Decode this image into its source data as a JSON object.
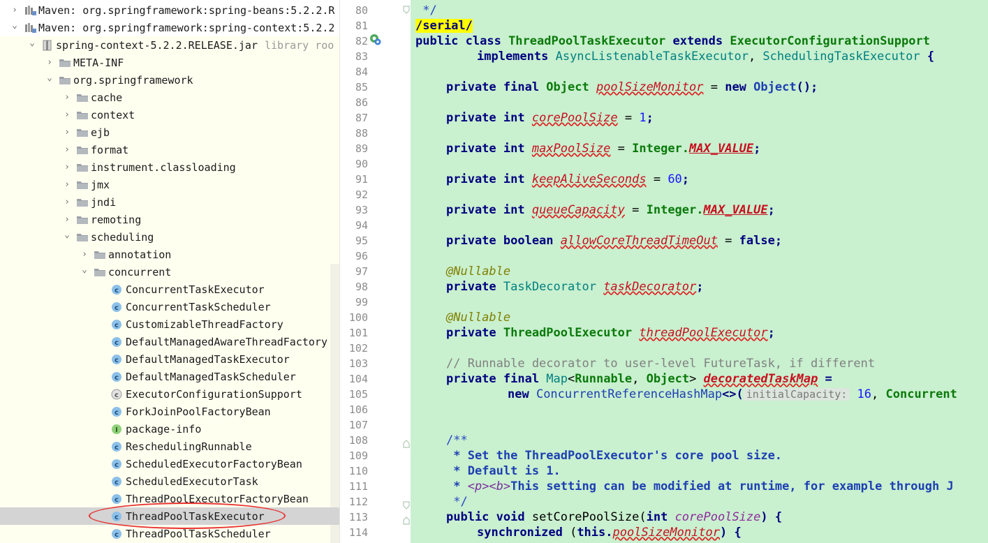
{
  "tree": {
    "rows": [
      {
        "label": "Maven: org.springframework:spring-beans:5.2.2.R",
        "arrow": "›",
        "icon": "library-icon",
        "indent": 0
      },
      {
        "label": "Maven: org.springframework:spring-context:5.2.2",
        "arrow": "⌄",
        "icon": "library-icon",
        "indent": 0
      },
      {
        "label": "spring-context-5.2.2.RELEASE.jar",
        "hint": "library roo",
        "arrow": "⌄",
        "icon": "jar-icon",
        "indent": 1
      },
      {
        "label": "META-INF",
        "arrow": "›",
        "icon": "folder-icon",
        "indent": 2
      },
      {
        "label": "org.springframework",
        "arrow": "⌄",
        "icon": "folder-icon",
        "indent": 2
      },
      {
        "label": "cache",
        "arrow": "›",
        "icon": "folder-icon",
        "indent": 3
      },
      {
        "label": "context",
        "arrow": "›",
        "icon": "folder-icon",
        "indent": 3
      },
      {
        "label": "ejb",
        "arrow": "›",
        "icon": "folder-icon",
        "indent": 3
      },
      {
        "label": "format",
        "arrow": "›",
        "icon": "folder-icon",
        "indent": 3
      },
      {
        "label": "instrument.classloading",
        "arrow": "›",
        "icon": "folder-icon",
        "indent": 3
      },
      {
        "label": "jmx",
        "arrow": "›",
        "icon": "folder-icon",
        "indent": 3
      },
      {
        "label": "jndi",
        "arrow": "›",
        "icon": "folder-icon",
        "indent": 3
      },
      {
        "label": "remoting",
        "arrow": "›",
        "icon": "folder-icon",
        "indent": 3
      },
      {
        "label": "scheduling",
        "arrow": "⌄",
        "icon": "folder-icon",
        "indent": 3
      },
      {
        "label": "annotation",
        "arrow": "›",
        "icon": "folder-icon",
        "indent": 4
      },
      {
        "label": "concurrent",
        "arrow": "⌄",
        "icon": "folder-icon",
        "indent": 4
      },
      {
        "label": "ConcurrentTaskExecutor",
        "arrow": "",
        "icon": "class-icon",
        "indent": 5
      },
      {
        "label": "ConcurrentTaskScheduler",
        "arrow": "",
        "icon": "class-icon",
        "indent": 5
      },
      {
        "label": "CustomizableThreadFactory",
        "arrow": "",
        "icon": "class-icon",
        "indent": 5
      },
      {
        "label": "DefaultManagedAwareThreadFactory",
        "arrow": "",
        "icon": "class-icon",
        "indent": 5
      },
      {
        "label": "DefaultManagedTaskExecutor",
        "arrow": "",
        "icon": "class-icon",
        "indent": 5
      },
      {
        "label": "DefaultManagedTaskScheduler",
        "arrow": "",
        "icon": "class-icon",
        "indent": 5
      },
      {
        "label": "ExecutorConfigurationSupport",
        "arrow": "",
        "icon": "abstract-class-icon",
        "indent": 5
      },
      {
        "label": "ForkJoinPoolFactoryBean",
        "arrow": "",
        "icon": "class-icon",
        "indent": 5
      },
      {
        "label": "package-info",
        "arrow": "",
        "icon": "interface-icon",
        "indent": 5
      },
      {
        "label": "ReschedulingRunnable",
        "arrow": "",
        "icon": "class-icon",
        "indent": 5
      },
      {
        "label": "ScheduledExecutorFactoryBean",
        "arrow": "",
        "icon": "class-icon",
        "indent": 5
      },
      {
        "label": "ScheduledExecutorTask",
        "arrow": "",
        "icon": "class-icon",
        "indent": 5
      },
      {
        "label": "ThreadPoolExecutorFactoryBean",
        "arrow": "",
        "icon": "class-icon",
        "indent": 5
      },
      {
        "label": "ThreadPoolTaskExecutor",
        "arrow": "",
        "icon": "class-icon",
        "indent": 5,
        "selected": true
      },
      {
        "label": "ThreadPoolTaskScheduler",
        "arrow": "",
        "icon": "class-icon",
        "indent": 5
      }
    ]
  },
  "gutter": {
    "line_numbers": [
      "80",
      "81",
      "82",
      "83",
      "84",
      "85",
      "86",
      "87",
      "88",
      "89",
      "90",
      "91",
      "92",
      "93",
      "94",
      "95",
      "96",
      "97",
      "98",
      "99",
      "100",
      "101",
      "102",
      "103",
      "104",
      "105",
      "106",
      "107",
      "108",
      "109",
      "110",
      "111",
      "112",
      "113",
      "114"
    ]
  },
  "code": {
    "l80": " */",
    "l81": "/serial/",
    "l82": {
      "k1": "public class ",
      "name": "ThreadPoolTaskExecutor",
      "k2": " extends ",
      "base": "ExecutorConfigurationSupport"
    },
    "l83": {
      "k": "implements ",
      "t1": "AsyncListenableTaskExecutor",
      "sep": ", ",
      "t2": "SchedulingTaskExecutor",
      "end": " {"
    },
    "l85": {
      "k": "private final ",
      "t": "Object ",
      "f": "poolSizeMonitor",
      "eq": " = ",
      "n": "new ",
      "t2": "Object",
      "end": "();"
    },
    "l87": {
      "k": "private int ",
      "f": "corePoolSize",
      "eq": " = ",
      "v": "1",
      "end": ";"
    },
    "l89": {
      "k": "private int ",
      "f": "maxPoolSize",
      "eq": " = ",
      "t": "Integer.",
      "c": "MAX_VALUE",
      "end": ";"
    },
    "l91": {
      "k": "private int ",
      "f": "keepAliveSeconds",
      "eq": " = ",
      "v": "60",
      "end": ";"
    },
    "l93": {
      "k": "private int ",
      "f": "queueCapacity",
      "eq": " = ",
      "t": "Integer.",
      "c": "MAX_VALUE",
      "end": ";"
    },
    "l95": {
      "k": "private boolean ",
      "f": "allowCoreThreadTimeOut",
      "eq": " = ",
      "v": "false",
      "end": ";"
    },
    "l97": "@Nullable",
    "l98": {
      "k": "private ",
      "t": "TaskDecorator ",
      "f": "taskDecorator",
      "end": ";"
    },
    "l100": "@Nullable",
    "l101": {
      "k": "private ",
      "t": "ThreadPoolExecutor ",
      "f": "threadPoolExecutor",
      "end": ";"
    },
    "l103": "// Runnable decorator to user-level FutureTask, if different",
    "l104": {
      "k": "private final ",
      "t": "Map",
      "lt": "<",
      "t2": "Runnable",
      "sep": ", ",
      "t3": "Object",
      "gt": "> ",
      "f": "decoratedTaskMap",
      "end": " ="
    },
    "l105": {
      "n": "new ",
      "t": "ConcurrentReferenceHashMap",
      "d": "<>(",
      "hint": "initialCapacity:",
      "v": "16",
      "sep": ", ",
      "rest": "Concurrent"
    },
    "l108": "/**",
    "l109": " * Set the ThreadPoolExecutor's core pool size.",
    "l110": " * Default is 1.",
    "l111": {
      "star": " * ",
      "tag": "<p><b>",
      "text": "This setting can be modified at runtime, for example through J"
    },
    "l112": " */",
    "l113": {
      "k": "public void ",
      "m": "setCorePoolSize",
      "o": "(",
      "k2": "int ",
      "p": "corePoolSize",
      "end": ") {"
    },
    "l114": {
      "k": "synchronized ",
      "o": "(",
      "k2": "this.",
      "f": "poolSizeMonitor",
      "end": ") {"
    }
  },
  "colors": {
    "editor_bg": "#c9f0cf",
    "keyword": "#000080",
    "field": "#c8101f",
    "selection": "#d4d4d4",
    "annotation_oval": "#e8312f"
  }
}
